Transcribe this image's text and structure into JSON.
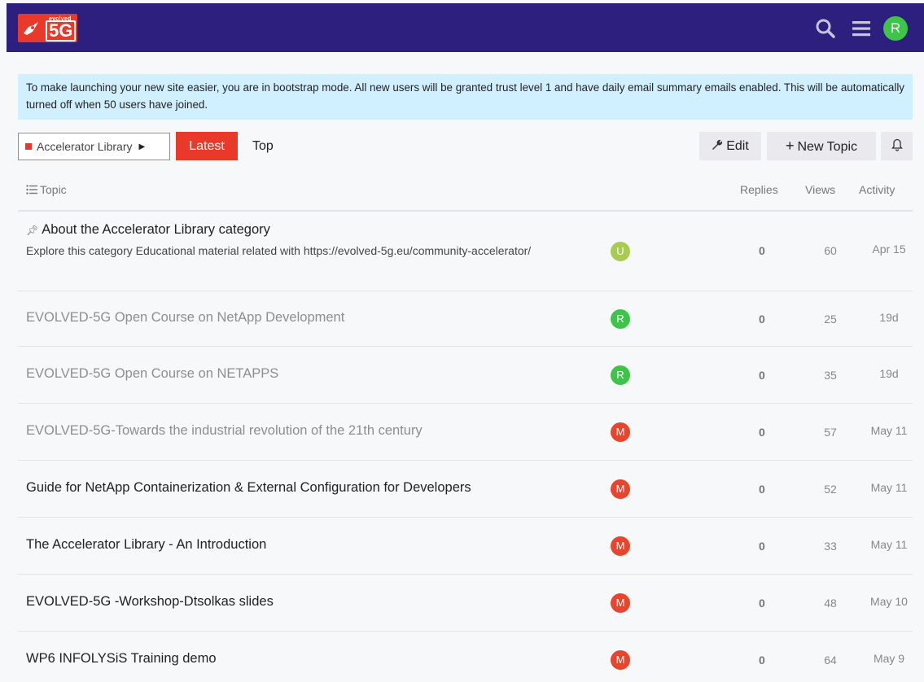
{
  "header": {
    "logo_small": "evolved",
    "logo_big": "5G",
    "user_initial": "R",
    "brand_color": "#2d1f7d",
    "accent_color": "#e8392a"
  },
  "banner": {
    "text": "To make launching your new site easier, you are in bootstrap mode. All new users will be granted trust level 1 and have daily email summary emails enabled. This will be automatically turned off when 50 users have joined."
  },
  "nav": {
    "category": "Accelerator Library",
    "latest": "Latest",
    "top": "Top",
    "edit": "Edit",
    "new_topic": "New Topic"
  },
  "list": {
    "columns": {
      "topic": "Topic",
      "replies": "Replies",
      "views": "Views",
      "activity": "Activity"
    },
    "rows": [
      {
        "title": "About the Accelerator Library category",
        "excerpt": "Explore this category Educational material related with https://evolved-5g.eu/community-accelerator/",
        "pinned": true,
        "visited": false,
        "avatar": "U",
        "avatar_color": "#a8cc4f",
        "replies": "0",
        "views": "60",
        "activity": "Apr 15"
      },
      {
        "title": "EVOLVED-5G Open Course on NetApp Development",
        "visited": true,
        "avatar": "R",
        "avatar_color": "#3ec449",
        "replies": "0",
        "views": "25",
        "activity": "19d"
      },
      {
        "title": "EVOLVED-5G Open Course on NETAPPS",
        "visited": true,
        "avatar": "R",
        "avatar_color": "#3ec449",
        "replies": "0",
        "views": "35",
        "activity": "19d"
      },
      {
        "title": "EVOLVED-5G-Towards the industrial revolution of the 21th century",
        "visited": true,
        "avatar": "M",
        "avatar_color": "#e8452c",
        "replies": "0",
        "views": "57",
        "activity": "May 11"
      },
      {
        "title": "Guide for NetApp Containerization & External Configuration for Developers",
        "visited": false,
        "avatar": "M",
        "avatar_color": "#e8452c",
        "replies": "0",
        "views": "52",
        "activity": "May 11"
      },
      {
        "title": "The Accelerator Library - An Introduction",
        "visited": false,
        "avatar": "M",
        "avatar_color": "#e8452c",
        "replies": "0",
        "views": "33",
        "activity": "May 11"
      },
      {
        "title": "EVOLVED-5G -Workshop-Dtsolkas slides",
        "visited": false,
        "avatar": "M",
        "avatar_color": "#e8452c",
        "replies": "0",
        "views": "48",
        "activity": "May 10"
      },
      {
        "title": "WP6 INFOLYSiS Training demo",
        "visited": false,
        "avatar": "M",
        "avatar_color": "#e8452c",
        "replies": "0",
        "views": "64",
        "activity": "May 9"
      }
    ]
  }
}
